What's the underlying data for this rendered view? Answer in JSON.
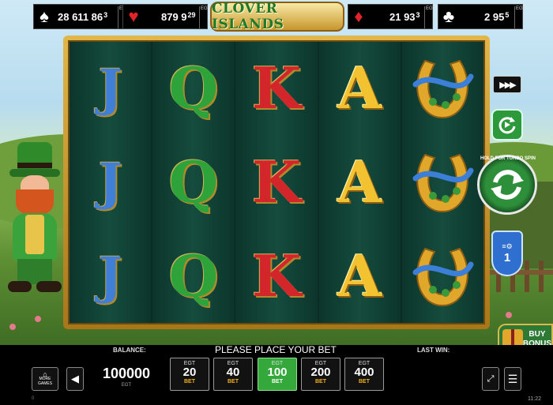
{
  "game": {
    "title": "CLOVER ISLANDS"
  },
  "jackpots": [
    {
      "suit": "spade",
      "glyph": "♠",
      "color": "#ffffff",
      "amount": "28 611 86",
      "sup": "3",
      "egt": "EGT"
    },
    {
      "suit": "heart",
      "glyph": "♥",
      "color": "#e0242a",
      "amount": "879 9",
      "sup": "29",
      "egt": "EGT"
    },
    {
      "suit": "diamond",
      "glyph": "♦",
      "color": "#e0242a",
      "amount": "21 93",
      "sup": "3",
      "egt": "EGT"
    },
    {
      "suit": "club",
      "glyph": "♣",
      "color": "#ffffff",
      "amount": "2 95",
      "sup": "5",
      "egt": "EGT"
    }
  ],
  "reels": [
    {
      "symbol": "J",
      "rows": [
        "J",
        "J",
        "J"
      ]
    },
    {
      "symbol": "Q",
      "rows": [
        "Q",
        "Q",
        "Q"
      ]
    },
    {
      "symbol": "K",
      "rows": [
        "K",
        "K",
        "K"
      ]
    },
    {
      "symbol": "A",
      "rows": [
        "A",
        "A",
        "A"
      ]
    },
    {
      "symbol": "horseshoe-icon",
      "rows": [
        "",
        "",
        ""
      ]
    }
  ],
  "controls": {
    "fast_forward": "▶▶▶",
    "spin_hint": "HOLD FOR TURBO SPIN",
    "lines_count": "1",
    "buy_label_1": "BUY",
    "buy_label_2": "BONUS"
  },
  "bottom": {
    "balance_label": "BALANCE:",
    "balance_value": "100000",
    "balance_unit": "EGT",
    "message": "PLEASE PLACE YOUR BET",
    "last_win_label": "LAST WIN:",
    "more_games": "MORE GAMES",
    "version": "0",
    "clock": "11:22"
  },
  "bets": [
    {
      "egt": "EGT",
      "value": "20",
      "label": "BET",
      "selected": false
    },
    {
      "egt": "EGT",
      "value": "40",
      "label": "BET",
      "selected": false
    },
    {
      "egt": "EGT",
      "value": "100",
      "label": "BET",
      "selected": true
    },
    {
      "egt": "EGT",
      "value": "200",
      "label": "BET",
      "selected": false
    },
    {
      "egt": "EGT",
      "value": "400",
      "label": "BET",
      "selected": false
    }
  ]
}
